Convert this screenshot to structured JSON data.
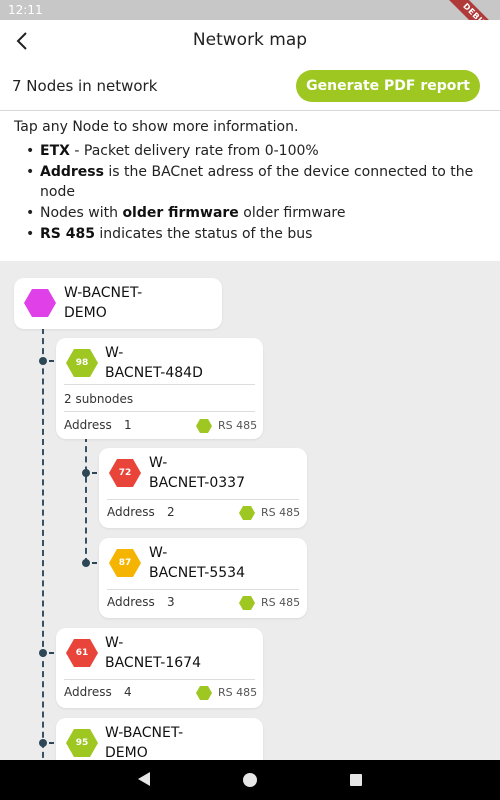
{
  "status_bar": {
    "time": "12:11"
  },
  "debug_banner": "DEBUG",
  "app_bar": {
    "title": "Network map"
  },
  "summary": {
    "node_count": "7 Nodes in network",
    "pdf_button": "Generate PDF report"
  },
  "info": {
    "intro": "Tap any Node to show more information.",
    "items": [
      {
        "bold": "ETX",
        "text": " - Packet delivery rate from 0-100%"
      },
      {
        "bold": "Address",
        "text": " is the BACnet adress of the device connected to the node"
      },
      {
        "prefix": "Nodes with ",
        "bold": "older firmware",
        "text": " older firmware"
      },
      {
        "bold": "RS 485",
        "text": " indicates the status of the bus"
      }
    ]
  },
  "colors": {
    "accent": "#9ec722",
    "root": "#e040e8",
    "etx_good": "#9ec722",
    "etx_bad": "#e8443a",
    "etx_warn": "#f5b400",
    "tree_line": "#2d4757"
  },
  "tree": {
    "root": {
      "name": "W-BACNET-\nDEMO"
    },
    "nodes": [
      {
        "etx": "98",
        "name": "W-\nBACNET-484D",
        "subnodes": "2 subnodes",
        "address_label": "Address",
        "address": "1",
        "rs485": "RS 485"
      },
      {
        "etx": "72",
        "name": "W-\nBACNET-0337",
        "address_label": "Address",
        "address": "2",
        "rs485": "RS 485"
      },
      {
        "etx": "87",
        "name": "W-\nBACNET-5534",
        "address_label": "Address",
        "address": "3",
        "rs485": "RS 485"
      },
      {
        "etx": "61",
        "name": "W-\nBACNET-1674",
        "address_label": "Address",
        "address": "4",
        "rs485": "RS 485"
      },
      {
        "etx": "95",
        "name": "W-BACNET-\nDEMO"
      }
    ]
  },
  "nav_bar": {
    "back": "back-icon",
    "home": "home-icon",
    "recents": "recents-icon"
  }
}
